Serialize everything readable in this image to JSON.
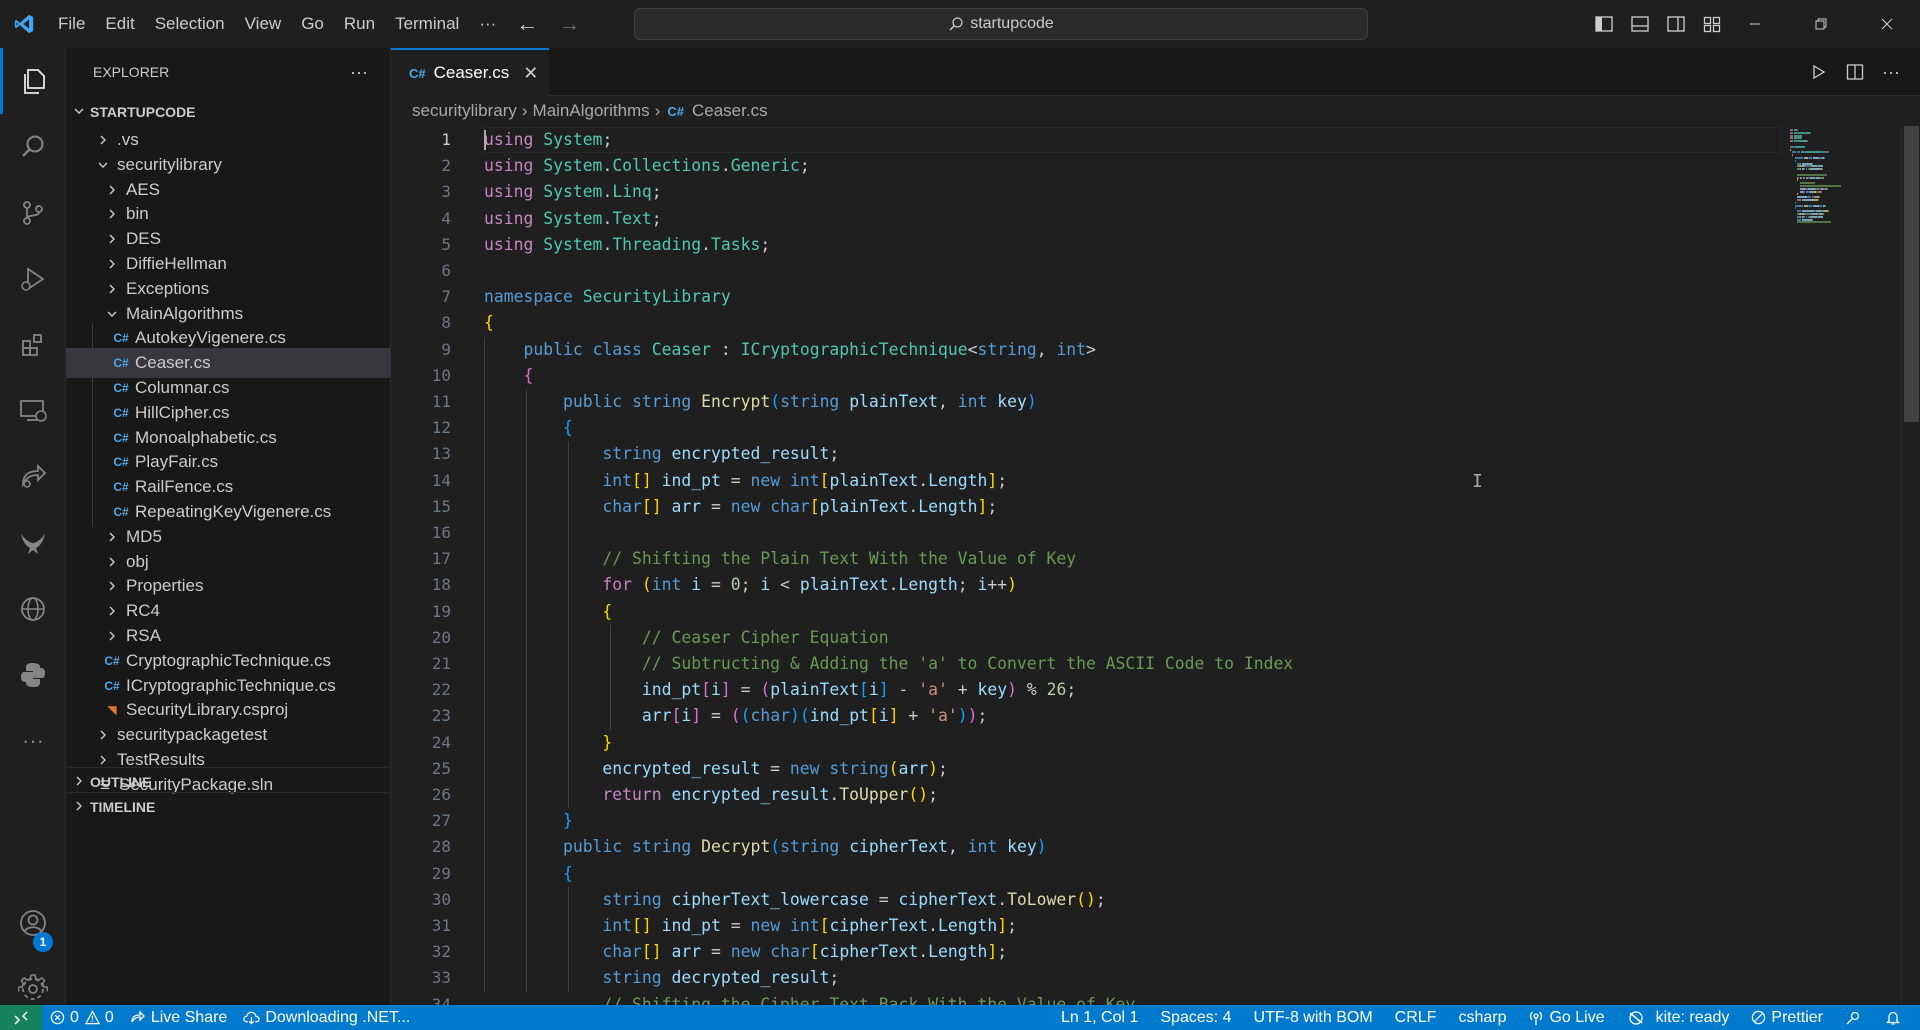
{
  "titlebar": {
    "menu": [
      "File",
      "Edit",
      "Selection",
      "View",
      "Go",
      "Run",
      "Terminal"
    ],
    "more": "···",
    "search": "startupcode"
  },
  "activity_bar": {
    "items": [
      "explorer-icon",
      "search-icon",
      "source-control-icon",
      "run-debug-icon",
      "extensions-icon",
      "remote-explorer-icon",
      "live-share-icon",
      "phoenix-icon",
      "globe-icon",
      "python-icon",
      "more-icon"
    ],
    "accounts_badge": "1"
  },
  "sidebar": {
    "title": "EXPLORER",
    "more": "···",
    "root": "STARTUPCODE",
    "tree": [
      {
        "label": ".vs",
        "type": "folder",
        "expanded": false,
        "depth": 1
      },
      {
        "label": "securitylibrary",
        "type": "folder",
        "expanded": true,
        "depth": 1
      },
      {
        "label": "AES",
        "type": "folder",
        "expanded": false,
        "depth": 2
      },
      {
        "label": "bin",
        "type": "folder",
        "expanded": false,
        "depth": 2
      },
      {
        "label": "DES",
        "type": "folder",
        "expanded": false,
        "depth": 2
      },
      {
        "label": "DiffieHellman",
        "type": "folder",
        "expanded": false,
        "depth": 2
      },
      {
        "label": "Exceptions",
        "type": "folder",
        "expanded": false,
        "depth": 2
      },
      {
        "label": "MainAlgorithms",
        "type": "folder",
        "expanded": true,
        "depth": 2
      },
      {
        "label": "AutokeyVigenere.cs",
        "type": "cs",
        "depth": 3
      },
      {
        "label": "Ceaser.cs",
        "type": "cs",
        "depth": 3,
        "selected": true
      },
      {
        "label": "Columnar.cs",
        "type": "cs",
        "depth": 3
      },
      {
        "label": "HillCipher.cs",
        "type": "cs",
        "depth": 3
      },
      {
        "label": "Monoalphabetic.cs",
        "type": "cs",
        "depth": 3
      },
      {
        "label": "PlayFair.cs",
        "type": "cs",
        "depth": 3
      },
      {
        "label": "RailFence.cs",
        "type": "cs",
        "depth": 3
      },
      {
        "label": "RepeatingKeyVigenere.cs",
        "type": "cs",
        "depth": 3
      },
      {
        "label": "MD5",
        "type": "folder",
        "expanded": false,
        "depth": 2
      },
      {
        "label": "obj",
        "type": "folder",
        "expanded": false,
        "depth": 2
      },
      {
        "label": "Properties",
        "type": "folder",
        "expanded": false,
        "depth": 2
      },
      {
        "label": "RC4",
        "type": "folder",
        "expanded": false,
        "depth": 2
      },
      {
        "label": "RSA",
        "type": "folder",
        "expanded": false,
        "depth": 2
      },
      {
        "label": "CryptographicTechnique.cs",
        "type": "cs",
        "depth": 2
      },
      {
        "label": "ICryptographicTechnique.cs",
        "type": "cs",
        "depth": 2
      },
      {
        "label": "SecurityLibrary.csproj",
        "type": "rss",
        "depth": 2
      },
      {
        "label": "securitypackagetest",
        "type": "folder",
        "expanded": false,
        "depth": 1
      },
      {
        "label": "TestResults",
        "type": "folder",
        "expanded": false,
        "depth": 1
      },
      {
        "label": "SecurityPackage.sln",
        "type": "sln",
        "depth": 1
      }
    ],
    "outline": "OUTLINE",
    "timeline": "TIMELINE"
  },
  "editor": {
    "tab": {
      "label": "Ceaser.cs",
      "close": "✕"
    },
    "breadcrumb": [
      "securitylibrary",
      "MainAlgorithms",
      "Ceaser.cs"
    ],
    "lines": [
      [
        [
          "ctl",
          "using"
        ],
        [
          "t",
          " "
        ],
        [
          "ty",
          "System"
        ],
        [
          "t",
          ";"
        ]
      ],
      [
        [
          "ctl",
          "using"
        ],
        [
          "t",
          " "
        ],
        [
          "ty",
          "System"
        ],
        [
          "t",
          "."
        ],
        [
          "ty",
          "Collections"
        ],
        [
          "t",
          "."
        ],
        [
          "ty",
          "Generic"
        ],
        [
          "t",
          ";"
        ]
      ],
      [
        [
          "ctl",
          "using"
        ],
        [
          "t",
          " "
        ],
        [
          "ty",
          "System"
        ],
        [
          "t",
          "."
        ],
        [
          "ty",
          "Linq"
        ],
        [
          "t",
          ";"
        ]
      ],
      [
        [
          "ctl",
          "using"
        ],
        [
          "t",
          " "
        ],
        [
          "ty",
          "System"
        ],
        [
          "t",
          "."
        ],
        [
          "ty",
          "Text"
        ],
        [
          "t",
          ";"
        ]
      ],
      [
        [
          "ctl",
          "using"
        ],
        [
          "t",
          " "
        ],
        [
          "ty",
          "System"
        ],
        [
          "t",
          "."
        ],
        [
          "ty",
          "Threading"
        ],
        [
          "t",
          "."
        ],
        [
          "ty",
          "Tasks"
        ],
        [
          "t",
          ";"
        ]
      ],
      [],
      [
        [
          "kw",
          "namespace"
        ],
        [
          "t",
          " "
        ],
        [
          "ty",
          "SecurityLibrary"
        ]
      ],
      [
        [
          "b1",
          "{"
        ]
      ],
      [
        [
          "t",
          "    "
        ],
        [
          "kw",
          "public"
        ],
        [
          "t",
          " "
        ],
        [
          "kw",
          "class"
        ],
        [
          "t",
          " "
        ],
        [
          "ty",
          "Ceaser"
        ],
        [
          "t",
          " : "
        ],
        [
          "ty",
          "ICryptographicTechnique"
        ],
        [
          "t",
          "<"
        ],
        [
          "kw",
          "string"
        ],
        [
          "t",
          ", "
        ],
        [
          "kw",
          "int"
        ],
        [
          "t",
          ">"
        ]
      ],
      [
        [
          "t",
          "    "
        ],
        [
          "b2",
          "{"
        ]
      ],
      [
        [
          "t",
          "        "
        ],
        [
          "kw",
          "public"
        ],
        [
          "t",
          " "
        ],
        [
          "kw",
          "string"
        ],
        [
          "t",
          " "
        ],
        [
          "fn",
          "Encrypt"
        ],
        [
          "b3",
          "("
        ],
        [
          "kw",
          "string"
        ],
        [
          "t",
          " "
        ],
        [
          "var",
          "plainText"
        ],
        [
          "t",
          ", "
        ],
        [
          "kw",
          "int"
        ],
        [
          "t",
          " "
        ],
        [
          "var",
          "key"
        ],
        [
          "b3",
          ")"
        ]
      ],
      [
        [
          "t",
          "        "
        ],
        [
          "b3",
          "{"
        ]
      ],
      [
        [
          "t",
          "            "
        ],
        [
          "kw",
          "string"
        ],
        [
          "t",
          " "
        ],
        [
          "var",
          "encrypted_result"
        ],
        [
          "t",
          ";"
        ]
      ],
      [
        [
          "t",
          "            "
        ],
        [
          "kw",
          "int"
        ],
        [
          "b1",
          "[]"
        ],
        [
          "t",
          " "
        ],
        [
          "var",
          "ind_pt"
        ],
        [
          "t",
          " = "
        ],
        [
          "kw",
          "new"
        ],
        [
          "t",
          " "
        ],
        [
          "kw",
          "int"
        ],
        [
          "b1",
          "["
        ],
        [
          "var",
          "plainText"
        ],
        [
          "t",
          "."
        ],
        [
          "var",
          "Length"
        ],
        [
          "b1",
          "]"
        ],
        [
          "t",
          ";"
        ]
      ],
      [
        [
          "t",
          "            "
        ],
        [
          "kw",
          "char"
        ],
        [
          "b1",
          "[]"
        ],
        [
          "t",
          " "
        ],
        [
          "var",
          "arr"
        ],
        [
          "t",
          " = "
        ],
        [
          "kw",
          "new"
        ],
        [
          "t",
          " "
        ],
        [
          "kw",
          "char"
        ],
        [
          "b1",
          "["
        ],
        [
          "var",
          "plainText"
        ],
        [
          "t",
          "."
        ],
        [
          "var",
          "Length"
        ],
        [
          "b1",
          "]"
        ],
        [
          "t",
          ";"
        ]
      ],
      [],
      [
        [
          "t",
          "            "
        ],
        [
          "cmt",
          "// Shifting the Plain Text With the Value of Key"
        ]
      ],
      [
        [
          "t",
          "            "
        ],
        [
          "ctl",
          "for"
        ],
        [
          "t",
          " "
        ],
        [
          "b1",
          "("
        ],
        [
          "kw",
          "int"
        ],
        [
          "t",
          " "
        ],
        [
          "var",
          "i"
        ],
        [
          "t",
          " = "
        ],
        [
          "num",
          "0"
        ],
        [
          "t",
          "; "
        ],
        [
          "var",
          "i"
        ],
        [
          "t",
          " < "
        ],
        [
          "var",
          "plainText"
        ],
        [
          "t",
          "."
        ],
        [
          "var",
          "Length"
        ],
        [
          "t",
          "; "
        ],
        [
          "var",
          "i"
        ],
        [
          "t",
          "++"
        ],
        [
          "b1",
          ")"
        ]
      ],
      [
        [
          "t",
          "            "
        ],
        [
          "b1",
          "{"
        ]
      ],
      [
        [
          "t",
          "                "
        ],
        [
          "cmt",
          "// Ceaser Cipher Equation"
        ]
      ],
      [
        [
          "t",
          "                "
        ],
        [
          "cmt",
          "// Subtructing & Adding the 'a' to Convert the ASCII Code to Index"
        ]
      ],
      [
        [
          "t",
          "                "
        ],
        [
          "var",
          "ind_pt"
        ],
        [
          "b2",
          "["
        ],
        [
          "var",
          "i"
        ],
        [
          "b2",
          "]"
        ],
        [
          "t",
          " = "
        ],
        [
          "b2",
          "("
        ],
        [
          "var",
          "plainText"
        ],
        [
          "b3",
          "["
        ],
        [
          "var",
          "i"
        ],
        [
          "b3",
          "]"
        ],
        [
          "t",
          " - "
        ],
        [
          "str",
          "'a'"
        ],
        [
          "t",
          " + "
        ],
        [
          "var",
          "key"
        ],
        [
          "b2",
          ")"
        ],
        [
          "t",
          " % "
        ],
        [
          "num",
          "26"
        ],
        [
          "t",
          ";"
        ]
      ],
      [
        [
          "t",
          "                "
        ],
        [
          "var",
          "arr"
        ],
        [
          "b2",
          "["
        ],
        [
          "var",
          "i"
        ],
        [
          "b2",
          "]"
        ],
        [
          "t",
          " = "
        ],
        [
          "b2",
          "("
        ],
        [
          "b3",
          "("
        ],
        [
          "kw",
          "char"
        ],
        [
          "b3",
          ")"
        ],
        [
          "b3",
          "("
        ],
        [
          "var",
          "ind_pt"
        ],
        [
          "b1",
          "["
        ],
        [
          "var",
          "i"
        ],
        [
          "b1",
          "]"
        ],
        [
          "t",
          " + "
        ],
        [
          "str",
          "'a'"
        ],
        [
          "b3",
          ")"
        ],
        [
          "b2",
          ")"
        ],
        [
          "t",
          ";"
        ]
      ],
      [
        [
          "t",
          "            "
        ],
        [
          "b1",
          "}"
        ]
      ],
      [
        [
          "t",
          "            "
        ],
        [
          "var",
          "encrypted_result"
        ],
        [
          "t",
          " = "
        ],
        [
          "kw",
          "new"
        ],
        [
          "t",
          " "
        ],
        [
          "kw",
          "string"
        ],
        [
          "b1",
          "("
        ],
        [
          "var",
          "arr"
        ],
        [
          "b1",
          ")"
        ],
        [
          "t",
          ";"
        ]
      ],
      [
        [
          "t",
          "            "
        ],
        [
          "ctl",
          "return"
        ],
        [
          "t",
          " "
        ],
        [
          "var",
          "encrypted_result"
        ],
        [
          "t",
          "."
        ],
        [
          "fn",
          "ToUpper"
        ],
        [
          "b1",
          "()"
        ],
        [
          "t",
          ";"
        ]
      ],
      [
        [
          "t",
          "        "
        ],
        [
          "b3",
          "}"
        ]
      ],
      [
        [
          "t",
          "        "
        ],
        [
          "kw",
          "public"
        ],
        [
          "t",
          " "
        ],
        [
          "kw",
          "string"
        ],
        [
          "t",
          " "
        ],
        [
          "fn",
          "Decrypt"
        ],
        [
          "b3",
          "("
        ],
        [
          "kw",
          "string"
        ],
        [
          "t",
          " "
        ],
        [
          "var",
          "cipherText"
        ],
        [
          "t",
          ", "
        ],
        [
          "kw",
          "int"
        ],
        [
          "t",
          " "
        ],
        [
          "var",
          "key"
        ],
        [
          "b3",
          ")"
        ]
      ],
      [
        [
          "t",
          "        "
        ],
        [
          "b3",
          "{"
        ]
      ],
      [
        [
          "t",
          "            "
        ],
        [
          "kw",
          "string"
        ],
        [
          "t",
          " "
        ],
        [
          "var",
          "cipherText_lowercase"
        ],
        [
          "t",
          " = "
        ],
        [
          "var",
          "cipherText"
        ],
        [
          "t",
          "."
        ],
        [
          "fn",
          "ToLower"
        ],
        [
          "b1",
          "()"
        ],
        [
          "t",
          ";"
        ]
      ],
      [
        [
          "t",
          "            "
        ],
        [
          "kw",
          "int"
        ],
        [
          "b1",
          "[]"
        ],
        [
          "t",
          " "
        ],
        [
          "var",
          "ind_pt"
        ],
        [
          "t",
          " = "
        ],
        [
          "kw",
          "new"
        ],
        [
          "t",
          " "
        ],
        [
          "kw",
          "int"
        ],
        [
          "b1",
          "["
        ],
        [
          "var",
          "cipherText"
        ],
        [
          "t",
          "."
        ],
        [
          "var",
          "Length"
        ],
        [
          "b1",
          "]"
        ],
        [
          "t",
          ";"
        ]
      ],
      [
        [
          "t",
          "            "
        ],
        [
          "kw",
          "char"
        ],
        [
          "b1",
          "[]"
        ],
        [
          "t",
          " "
        ],
        [
          "var",
          "arr"
        ],
        [
          "t",
          " = "
        ],
        [
          "kw",
          "new"
        ],
        [
          "t",
          " "
        ],
        [
          "kw",
          "char"
        ],
        [
          "b1",
          "["
        ],
        [
          "var",
          "cipherText"
        ],
        [
          "t",
          "."
        ],
        [
          "var",
          "Length"
        ],
        [
          "b1",
          "]"
        ],
        [
          "t",
          ";"
        ]
      ],
      [
        [
          "t",
          "            "
        ],
        [
          "kw",
          "string"
        ],
        [
          "t",
          " "
        ],
        [
          "var",
          "decrypted_result"
        ],
        [
          "t",
          ";"
        ]
      ],
      [
        [
          "t",
          "            "
        ],
        [
          "cmt",
          "// Shifting the Cipher Text Back With the Value of Key"
        ]
      ]
    ]
  },
  "statusbar": {
    "errors": "0",
    "warnings": "0",
    "live_share": "Live Share",
    "downloading": "Downloading .NET...",
    "position": "Ln 1, Col 1",
    "spaces": "Spaces: 4",
    "encoding": "UTF-8 with BOM",
    "eol": "CRLF",
    "language": "csharp",
    "go_live": "Go Live",
    "kite": "kite: ready",
    "prettier": "Prettier"
  },
  "colors": {
    "accent": "#0078d4",
    "statusbar": "#007acc",
    "remote": "#16825d"
  }
}
